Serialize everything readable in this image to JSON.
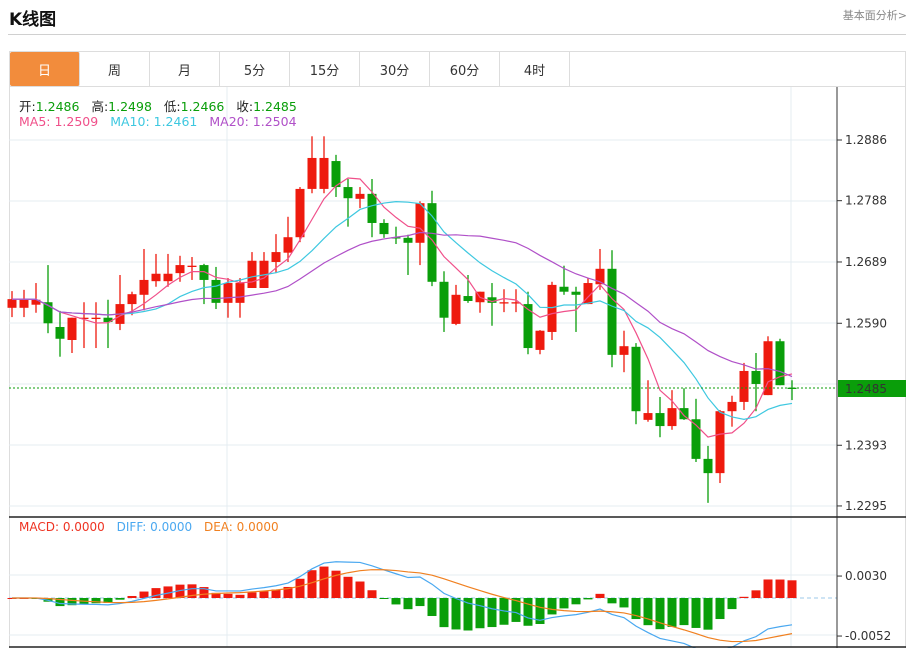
{
  "header": {
    "title": "K线图",
    "fundamental_link": "基本面分析>"
  },
  "tabs": [
    {
      "label": "日",
      "active": true
    },
    {
      "label": "周"
    },
    {
      "label": "月"
    },
    {
      "label": "5分"
    },
    {
      "label": "15分"
    },
    {
      "label": "30分"
    },
    {
      "label": "60分"
    },
    {
      "label": "4时"
    }
  ],
  "ohlc_info": {
    "open_label": "开:",
    "open": "1.2486",
    "high_label": "高:",
    "high": "1.2498",
    "low_label": "低:",
    "low": "1.2466",
    "close_label": "收:",
    "close": "1.2485"
  },
  "ma_info": {
    "ma5": "MA5: 1.2509",
    "ma10": "MA10: 1.2461",
    "ma20": "MA20: 1.2504"
  },
  "macd_info": {
    "macd": "MACD: 0.0000",
    "diff": "DIFF: 0.0000",
    "dea": "DEA: 0.0000"
  },
  "current_price": "1.2485",
  "colors": {
    "up": "#ee1a0e",
    "down": "#0a9e0a",
    "ma5": "#f0508a",
    "ma10": "#3ec8e0",
    "ma20": "#b050c8",
    "diff": "#4aa8f0",
    "dea": "#f08020",
    "tab_active": "#f28c3c"
  },
  "chart_data": {
    "type": "candlestick",
    "price_ticks": [
      "1.2886",
      "1.2788",
      "1.2689",
      "1.2590",
      "1.2393",
      "1.2295"
    ],
    "macd_ticks": [
      "0.0030",
      "-0.0052"
    ],
    "ylim": [
      1.227,
      1.2905
    ],
    "candles": [
      [
        1.2615,
        1.2642,
        1.26,
        1.2629
      ],
      [
        1.2615,
        1.2644,
        1.26,
        1.2629
      ],
      [
        1.262,
        1.2655,
        1.2607,
        1.2628
      ],
      [
        1.2624,
        1.2684,
        1.2574,
        1.259
      ],
      [
        1.2584,
        1.261,
        1.2536,
        1.2565
      ],
      [
        1.2563,
        1.2599,
        1.2542,
        1.2599
      ],
      [
        1.2599,
        1.2624,
        1.255,
        1.2599
      ],
      [
        1.2599,
        1.2624,
        1.255,
        1.2599
      ],
      [
        1.2599,
        1.2628,
        1.255,
        1.2592
      ],
      [
        1.2589,
        1.2668,
        1.2579,
        1.2621
      ],
      [
        1.2621,
        1.2641,
        1.2603,
        1.2637
      ],
      [
        1.2636,
        1.271,
        1.2611,
        1.266
      ],
      [
        1.2658,
        1.2702,
        1.2649,
        1.267
      ],
      [
        1.2658,
        1.2702,
        1.2649,
        1.267
      ],
      [
        1.2671,
        1.2699,
        1.2657,
        1.2684
      ],
      [
        1.2683,
        1.2697,
        1.266,
        1.2683
      ],
      [
        1.2684,
        1.2686,
        1.2621,
        1.266
      ],
      [
        1.266,
        1.2681,
        1.2613,
        1.2623
      ],
      [
        1.2623,
        1.2663,
        1.2599,
        1.2655
      ],
      [
        1.2623,
        1.2663,
        1.2599,
        1.2655
      ],
      [
        1.2647,
        1.2705,
        1.2647,
        1.2691
      ],
      [
        1.2647,
        1.2705,
        1.2647,
        1.2691
      ],
      [
        1.2689,
        1.2734,
        1.2671,
        1.2705
      ],
      [
        1.2704,
        1.2762,
        1.2689,
        1.2729
      ],
      [
        1.2729,
        1.281,
        1.2721,
        1.2807
      ],
      [
        1.2807,
        1.2892,
        1.28,
        1.2857
      ],
      [
        1.2807,
        1.2892,
        1.28,
        1.2857
      ],
      [
        1.2852,
        1.2862,
        1.2794,
        1.281
      ],
      [
        1.281,
        1.2823,
        1.2746,
        1.2792
      ],
      [
        1.2791,
        1.281,
        1.2776,
        1.2799
      ],
      [
        1.2799,
        1.2823,
        1.2729,
        1.2752
      ],
      [
        1.2752,
        1.2758,
        1.2728,
        1.2734
      ],
      [
        1.2729,
        1.2746,
        1.2718,
        1.2728
      ],
      [
        1.2728,
        1.2733,
        1.2668,
        1.272
      ],
      [
        1.272,
        1.2787,
        1.2684,
        1.2784
      ],
      [
        1.2784,
        1.2804,
        1.265,
        1.2657
      ],
      [
        1.2657,
        1.2674,
        1.2576,
        1.2599
      ],
      [
        1.2589,
        1.2652,
        1.2587,
        1.2636
      ],
      [
        1.2634,
        1.2668,
        1.2623,
        1.2626
      ],
      [
        1.2624,
        1.2641,
        1.2607,
        1.2641
      ],
      [
        1.2632,
        1.2655,
        1.2586,
        1.2623
      ],
      [
        1.2624,
        1.2645,
        1.2608,
        1.2624
      ],
      [
        1.2624,
        1.2645,
        1.2608,
        1.2624
      ],
      [
        1.2621,
        1.2641,
        1.254,
        1.255
      ],
      [
        1.2547,
        1.2579,
        1.254,
        1.2578
      ],
      [
        1.2576,
        1.2657,
        1.2563,
        1.2652
      ],
      [
        1.2649,
        1.2683,
        1.2636,
        1.2641
      ],
      [
        1.2641,
        1.2649,
        1.2576,
        1.2636
      ],
      [
        1.2621,
        1.2663,
        1.2621,
        1.2655
      ],
      [
        1.2653,
        1.271,
        1.2644,
        1.2678
      ],
      [
        1.2678,
        1.2708,
        1.2519,
        1.2539
      ],
      [
        1.2539,
        1.2578,
        1.2511,
        1.2553
      ],
      [
        1.2552,
        1.2558,
        1.2427,
        1.2448
      ],
      [
        1.2434,
        1.2498,
        1.2431,
        1.2445
      ],
      [
        1.2445,
        1.2471,
        1.2406,
        1.2424
      ],
      [
        1.2424,
        1.2482,
        1.2418,
        1.2453
      ],
      [
        1.2453,
        1.2485,
        1.2434,
        1.2435
      ],
      [
        1.2435,
        1.2468,
        1.2366,
        1.2371
      ],
      [
        1.2371,
        1.2392,
        1.23,
        1.2348
      ],
      [
        1.2348,
        1.245,
        1.2332,
        1.2448
      ],
      [
        1.2448,
        1.2473,
        1.2423,
        1.2463
      ],
      [
        1.2463,
        1.2526,
        1.245,
        1.2513
      ],
      [
        1.2513,
        1.2542,
        1.2448,
        1.2492
      ],
      [
        1.2474,
        1.2569,
        1.2474,
        1.2561
      ],
      [
        1.2561,
        1.2565,
        1.249,
        1.249
      ],
      [
        1.2486,
        1.2498,
        1.2466,
        1.2485
      ]
    ]
  }
}
